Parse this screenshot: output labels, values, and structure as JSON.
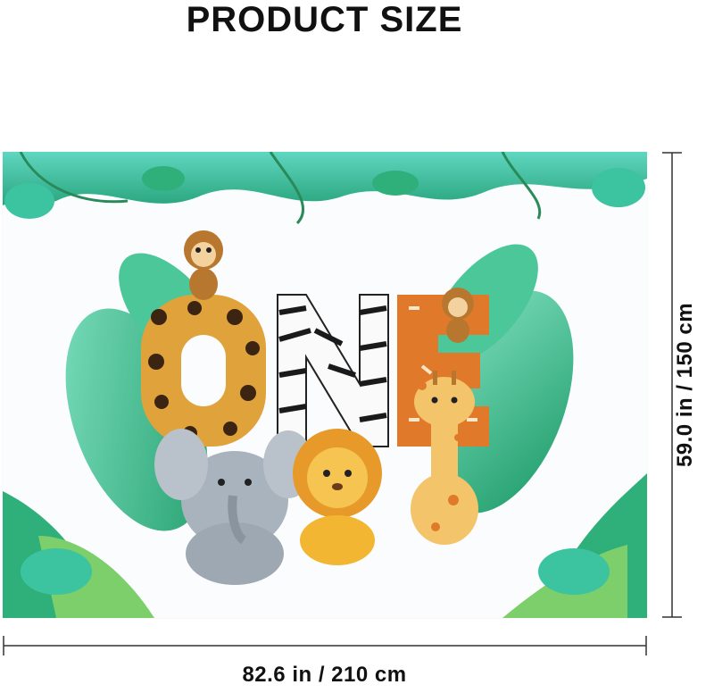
{
  "header": {
    "title": "PRODUCT SIZE"
  },
  "dimensions": {
    "height_label": "59.0 in / 150 cm",
    "width_label": "82.6 in / 210 cm"
  },
  "artwork": {
    "word": "ONE",
    "animals": [
      "monkey",
      "elephant",
      "lion",
      "giraffe"
    ],
    "colors": {
      "leaf_green": "#2fb07a",
      "leaf_teal": "#39c9b0",
      "leopard": "#e0a23a",
      "giraffe": "#e07a2a",
      "zebra": "#1a1a1a",
      "lion": "#f2b632",
      "elephant": "#a9b3bd"
    }
  }
}
